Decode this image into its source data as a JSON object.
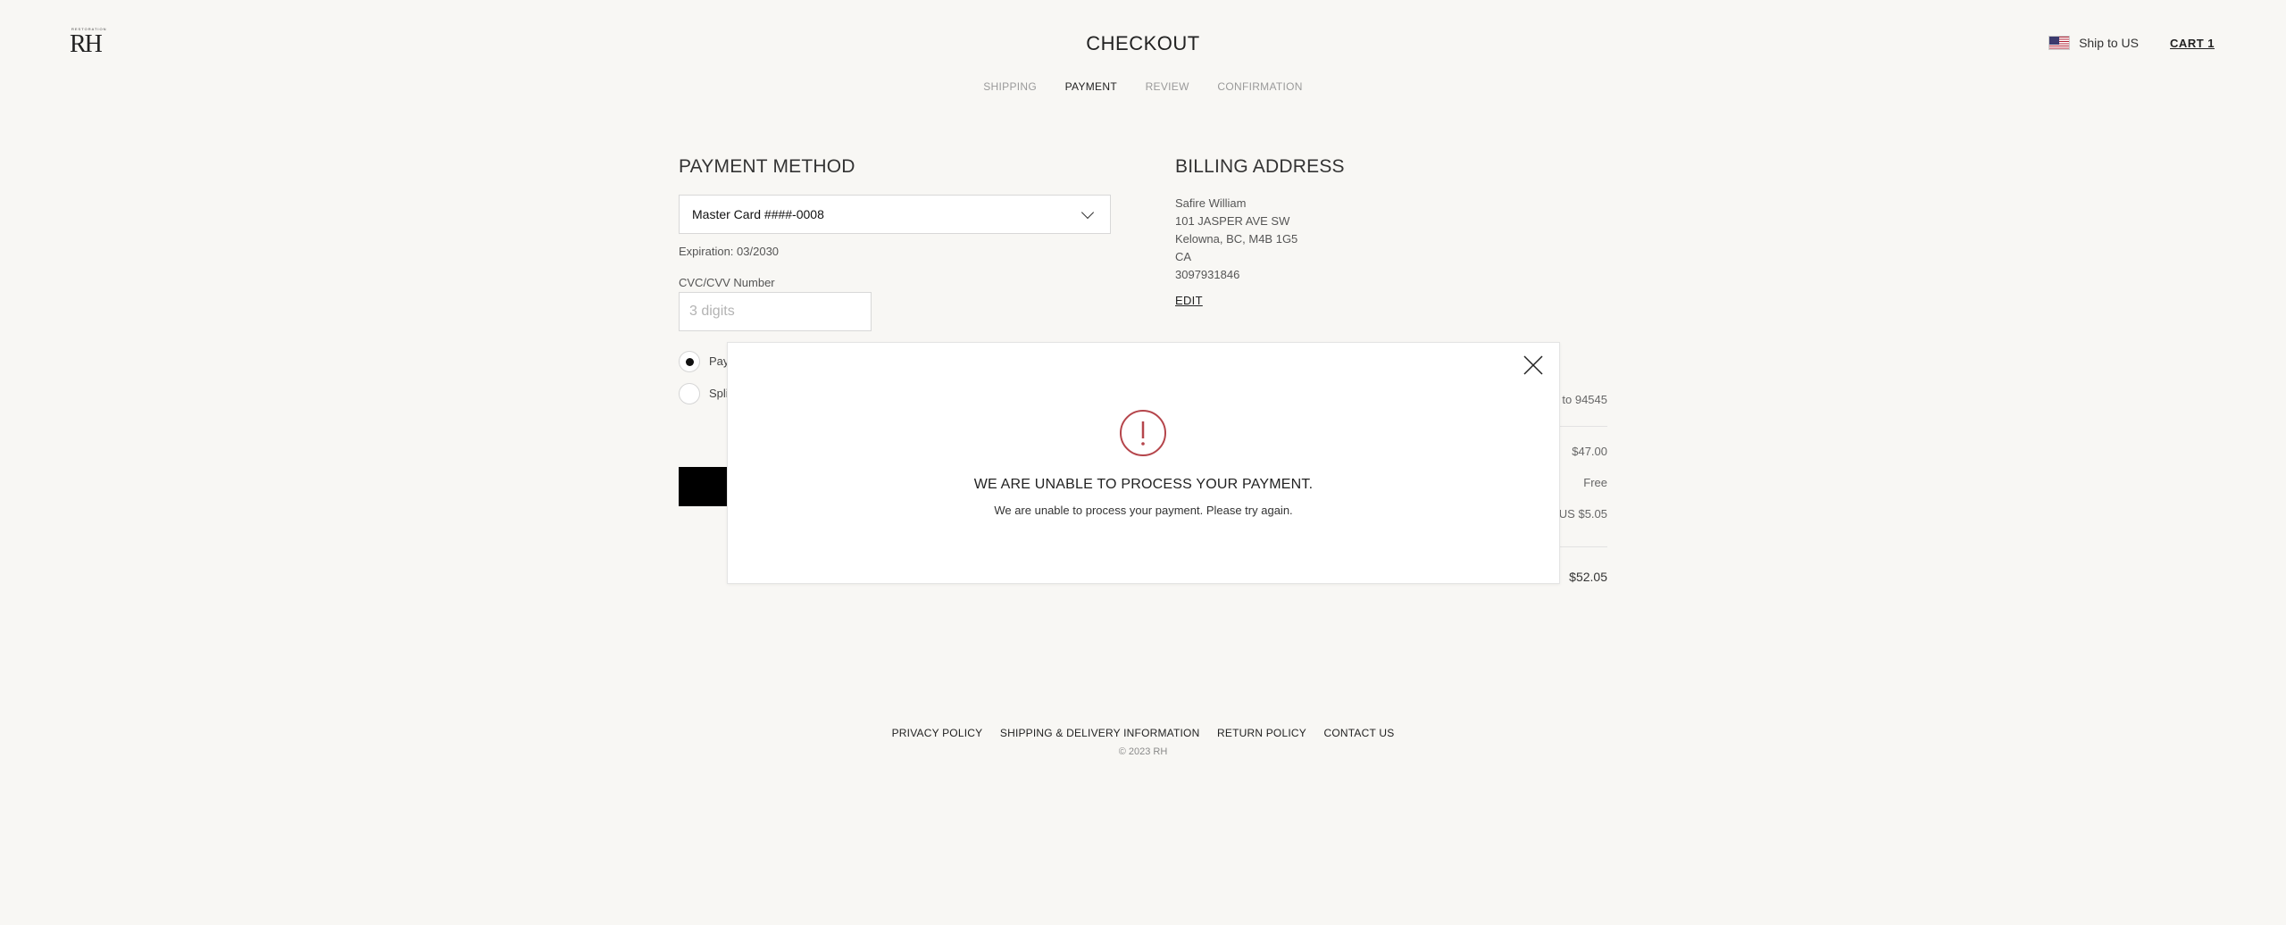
{
  "header": {
    "logo_small": "RESTORATION",
    "logo_text": "RH",
    "title": "CHECKOUT",
    "steps": [
      "SHIPPING",
      "PAYMENT",
      "REVIEW",
      "CONFIRMATION"
    ],
    "active_step": "PAYMENT",
    "ship_to": "Ship to US",
    "cart": "CART 1"
  },
  "payment": {
    "title": "PAYMENT METHOD",
    "selected_card": "Master Card ####-0008",
    "expiration": "Expiration: 03/2030",
    "cvc_label": "CVC/CVV Number",
    "cvc_placeholder": "3 digits",
    "cvc_value": "",
    "options": [
      "Pay",
      "Spli"
    ]
  },
  "billing": {
    "title": "BILLING ADDRESS",
    "name": "Safire William",
    "street": "101 JASPER AVE SW",
    "city": "Kelowna, BC, M4B 1G5",
    "country": "CA",
    "phone": "3097931846",
    "edit": "EDIT"
  },
  "summary": {
    "ship_to_zip": "to 94545",
    "subtotal": "$47.00",
    "shipping": "Free",
    "tax": "US $5.05",
    "total": "$52.05"
  },
  "modal": {
    "title": "WE ARE UNABLE TO PROCESS YOUR PAYMENT.",
    "message": "We are unable to process your payment. Please try again.",
    "accent": "#b5454b"
  },
  "footer": {
    "links": [
      "PRIVACY POLICY",
      "SHIPPING & DELIVERY INFORMATION",
      "RETURN POLICY",
      "CONTACT US"
    ],
    "copyright": "© 2023 RH"
  }
}
